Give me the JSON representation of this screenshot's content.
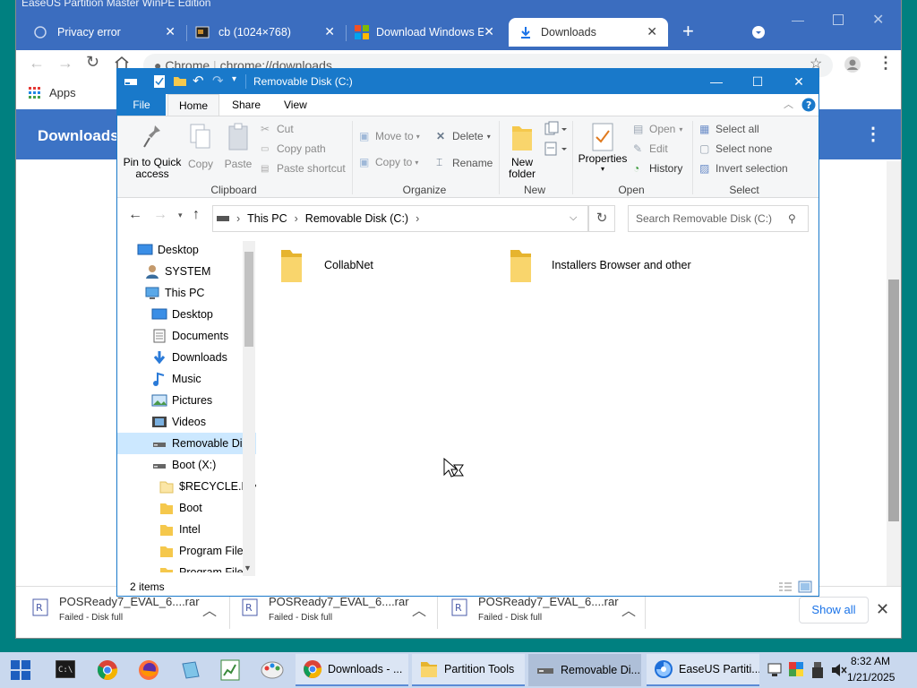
{
  "chrome": {
    "window_title": "EaseUS Partition Master WinPE Edition",
    "tabs": [
      {
        "label": "Privacy error"
      },
      {
        "label": "cb (1024×768)"
      },
      {
        "label": "Download Windows E"
      },
      {
        "label": "Downloads"
      }
    ],
    "url_prefix": "Chrome",
    "url": "chrome://downloads",
    "bookmarks": {
      "apps_label": "Apps"
    },
    "page_title": "Downloads",
    "downloads_bar": {
      "items": [
        {
          "name": "POSReady7_EVAL_6....rar",
          "status": "Failed - Disk full"
        },
        {
          "name": "POSReady7_EVAL_6....rar",
          "status": "Failed - Disk full"
        },
        {
          "name": "POSReady7_EVAL_6....rar",
          "status": "Failed - Disk full"
        }
      ],
      "show_all": "Show all"
    }
  },
  "explorer": {
    "title": "Removable Disk (C:)",
    "menu_tabs": [
      "File",
      "Home",
      "Share",
      "View"
    ],
    "ribbon": {
      "clipboard": {
        "pin": "Pin to Quick access",
        "copy": "Copy",
        "paste": "Paste",
        "cut": "Cut",
        "copy_path": "Copy path",
        "paste_shortcut": "Paste shortcut",
        "group": "Clipboard"
      },
      "organize": {
        "move_to": "Move to",
        "copy_to": "Copy to",
        "delete": "Delete",
        "rename": "Rename",
        "group": "Organize"
      },
      "new": {
        "new_folder": "New folder",
        "group": "New"
      },
      "open": {
        "properties": "Properties",
        "open": "Open",
        "edit": "Edit",
        "history": "History",
        "group": "Open"
      },
      "select": {
        "select_all": "Select all",
        "select_none": "Select none",
        "invert": "Invert selection",
        "group": "Select"
      }
    },
    "address": {
      "crumbs": [
        "This PC",
        "Removable Disk (C:)"
      ]
    },
    "search_placeholder": "Search Removable Disk (C:)",
    "nav": [
      {
        "label": "Desktop",
        "icon": "desktop-icon"
      },
      {
        "label": "SYSTEM",
        "icon": "user-icon"
      },
      {
        "label": "This PC",
        "icon": "computer-icon"
      },
      {
        "label": "Desktop",
        "icon": "desktop-icon"
      },
      {
        "label": "Documents",
        "icon": "documents-icon"
      },
      {
        "label": "Downloads",
        "icon": "downloads-icon"
      },
      {
        "label": "Music",
        "icon": "music-icon"
      },
      {
        "label": "Pictures",
        "icon": "pictures-icon"
      },
      {
        "label": "Videos",
        "icon": "videos-icon"
      },
      {
        "label": "Removable Disk",
        "icon": "drive-icon"
      },
      {
        "label": "Boot (X:)",
        "icon": "drive-icon"
      },
      {
        "label": "$RECYCLE.BIN",
        "icon": "folder-icon"
      },
      {
        "label": "Boot",
        "icon": "folder-icon"
      },
      {
        "label": "Intel",
        "icon": "folder-icon"
      },
      {
        "label": "Program Files",
        "icon": "folder-icon"
      },
      {
        "label": "Program Files",
        "icon": "folder-icon"
      }
    ],
    "files": [
      {
        "name": "CollabNet"
      },
      {
        "name": "Installers Browser and other"
      }
    ],
    "status": "2 items"
  },
  "taskbar": {
    "apps": [
      {
        "label": "Downloads - ..."
      },
      {
        "label": "Partition Tools"
      },
      {
        "label": "Removable Di..."
      },
      {
        "label": "EaseUS Partiti..."
      }
    ],
    "time": "8:32 AM",
    "date": "1/21/2025"
  },
  "colors": {
    "chrome_frame": "#3b6dbf",
    "chrome_header": "#3c73c5",
    "explorer_accent": "#1979ca",
    "taskbar": "#c9d8ee",
    "folder": "#f5c84c"
  }
}
